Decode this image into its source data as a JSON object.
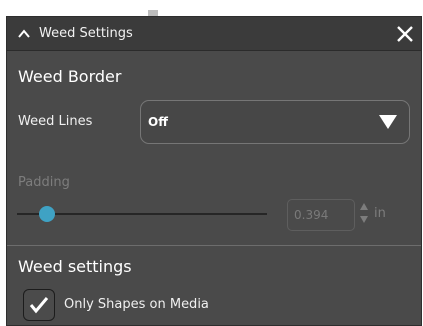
{
  "dialog": {
    "title": "Weed Settings",
    "collapse_icon": "chevron-up-icon",
    "close_icon": "close-icon"
  },
  "weed_border": {
    "section_title": "Weed Border",
    "weed_lines_label": "Weed Lines",
    "weed_lines_value": "Off",
    "padding_label": "Padding",
    "padding_value": "0.394",
    "padding_unit": "in",
    "padding_slider_level": 0.12,
    "padding_enabled": false
  },
  "weed_settings": {
    "section_title": "Weed settings",
    "only_shapes_label": "Only Shapes on Media",
    "only_shapes_checked": true
  },
  "colors": {
    "panel_bg": "#4a4a4a",
    "titlebar_bg": "#3b3b3b",
    "accent": "#3fa2c4",
    "text": "#f0f0f0",
    "disabled_text": "#7d7d7d"
  }
}
